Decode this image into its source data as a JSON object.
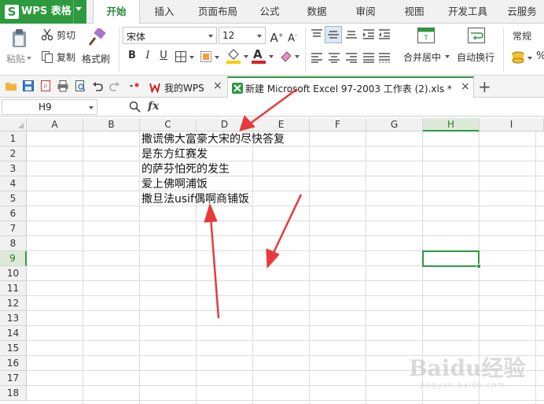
{
  "app": {
    "name": "WPS 表格",
    "logo_letter": "S"
  },
  "menu_tabs": [
    "开始",
    "插入",
    "页面布局",
    "公式",
    "数据",
    "审阅",
    "视图",
    "开发工具",
    "云服务"
  ],
  "ribbon": {
    "paste_label": "粘贴",
    "cut_label": "剪切",
    "copy_label": "复制",
    "format_painter_label": "格式刷",
    "font_name": "宋体",
    "font_size": "12",
    "merge_label": "合并居中",
    "wrap_label": "自动换行",
    "number_format": "常规",
    "percent_symbol": "%"
  },
  "doc_tabs": {
    "my_wps": "我的WPS",
    "current": "新建 Microsoft Excel 97-2003 工作表 (2).xls *",
    "add_symbol": "+"
  },
  "formula_bar": {
    "cell_ref": "H9",
    "fx_label": "fx",
    "content": ""
  },
  "sheet": {
    "columns": [
      "A",
      "B",
      "C",
      "D",
      "E",
      "F",
      "G",
      "H",
      "I"
    ],
    "selected_column": "H",
    "rows": [
      "1",
      "2",
      "3",
      "4",
      "5",
      "6",
      "7",
      "8",
      "9",
      "10",
      "11",
      "12",
      "13",
      "14",
      "15",
      "16",
      "17",
      "18"
    ],
    "selected_row": "9",
    "active_cell": "H9",
    "cells": [
      {
        "ref": "C1",
        "text": "撒谎佛大富豪大宋的尽快答复"
      },
      {
        "ref": "C2",
        "text": "是东方红赛发"
      },
      {
        "ref": "C3",
        "text": "的萨芬怕死的发生"
      },
      {
        "ref": "C4",
        "text": "爱上佛啊浦饭"
      },
      {
        "ref": "C5",
        "text": "撒旦法usif偶啊商铺饭"
      }
    ]
  },
  "annotations": {
    "arrow_color": "#e83a3a"
  },
  "watermark": {
    "brand": "Baidu经验",
    "sub": "jingyan.baidu.com"
  },
  "colors": {
    "accent": "#2d9a3f",
    "tab_active": "#2a8a3a",
    "font_color_bar": "#e02020",
    "fill_color_bar": "#f3d200"
  }
}
